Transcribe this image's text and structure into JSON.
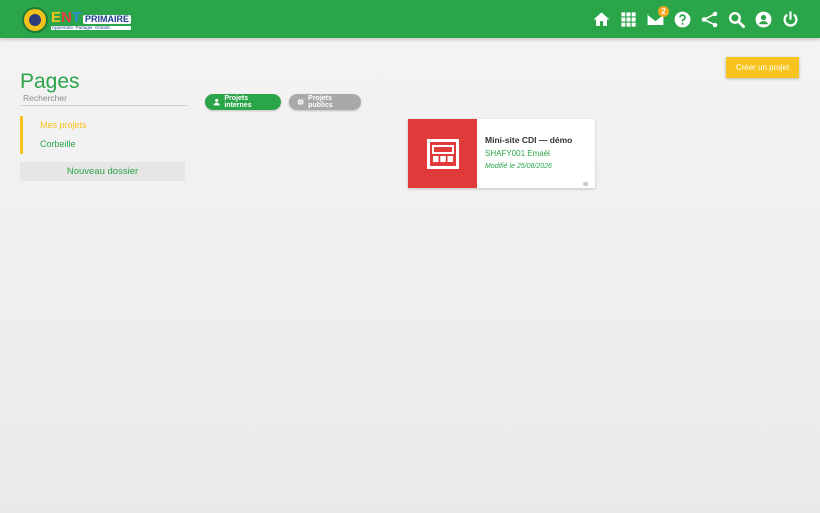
{
  "header": {
    "logo": {
      "e": "E",
      "n": "N",
      "t": "T",
      "suffix": "PRIMAIRE",
      "tagline": "Apprendre. Partager. Grandir."
    },
    "nav_icons": [
      "home-icon",
      "apps-grid-icon",
      "mail-icon",
      "help-icon",
      "share-icon",
      "search-icon",
      "account-icon",
      "power-icon"
    ],
    "mail_badge": "2"
  },
  "page": {
    "title": "Pages",
    "create_button": "Créer un projet"
  },
  "sidebar": {
    "search_placeholder": "Rechercher",
    "items": [
      {
        "label": "Mes projets",
        "active": true
      },
      {
        "label": "Corbeille",
        "active": false
      }
    ],
    "new_folder": "Nouveau dossier"
  },
  "filters": {
    "internal": "Projets internes",
    "public": "Projets publics"
  },
  "projects": [
    {
      "title": "Mini-site CDI — démo",
      "owner": "SHAFY001 Emaël",
      "modified": "Modifié le 25/06/2026"
    }
  ],
  "colors": {
    "primary_green": "#2aa54a",
    "accent_yellow": "#f7c31d",
    "thumb_red": "#e03a3a",
    "chip_grey": "#a9a9a9"
  }
}
